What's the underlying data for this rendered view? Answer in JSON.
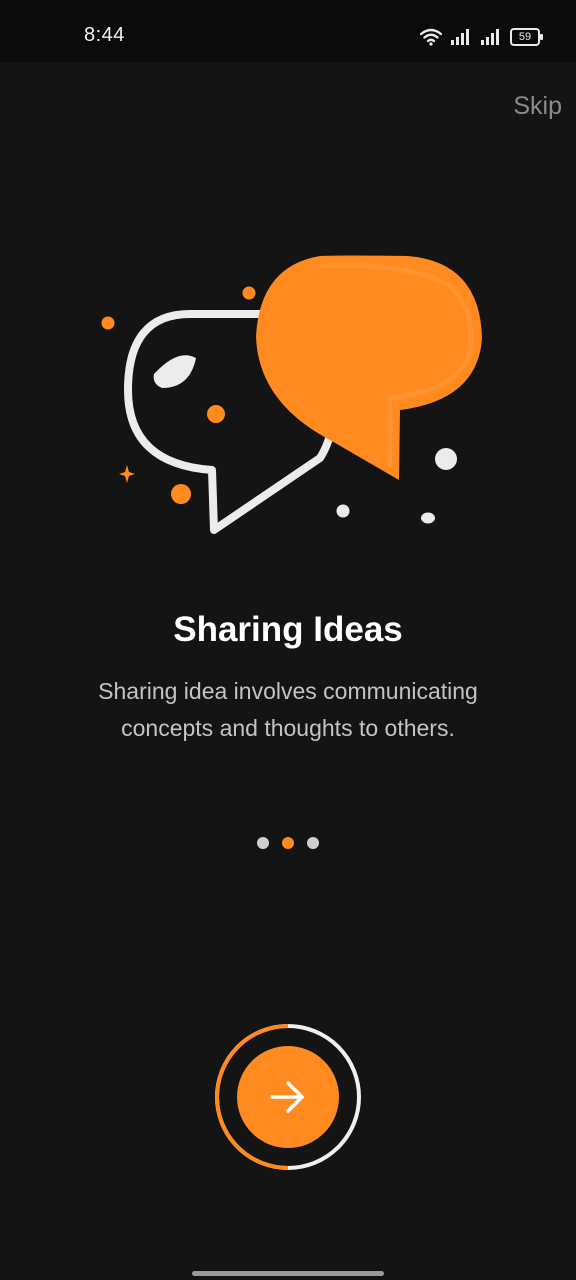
{
  "status_bar": {
    "time": "8:44",
    "battery": "59",
    "icons": [
      "wifi-icon",
      "signal-icon",
      "signal-icon",
      "battery-icon"
    ]
  },
  "skip_label": "Skip",
  "onboarding": {
    "title": "Sharing Ideas",
    "description": "Sharing idea involves communicating concepts and thoughts to others.",
    "page_count": 3,
    "current_page": 2,
    "progress": 0.5
  },
  "next_button": {
    "icon": "arrow-right-icon"
  },
  "colors": {
    "accent": "#ff8a1f",
    "background": "#141414",
    "title": "#ffffff",
    "description": "#c4c4c4",
    "skip": "#8b8b8b"
  }
}
